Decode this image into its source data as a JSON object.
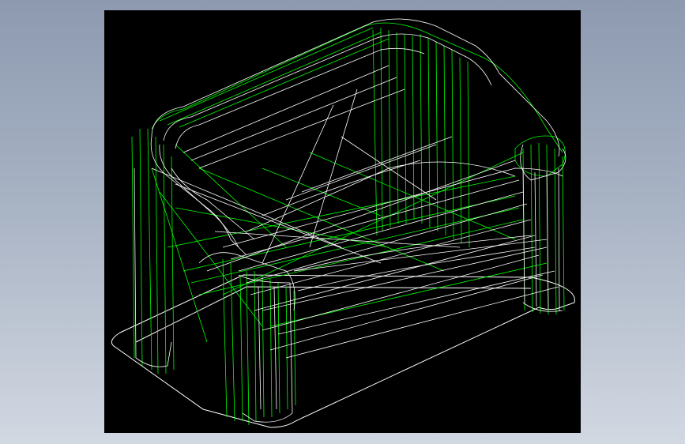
{
  "app": {
    "background_top": "#8d9ab0",
    "background_bottom": "#d2d8e2"
  },
  "viewport": {
    "background": "#000000",
    "render_mode": "wireframe",
    "model": "sofa",
    "colors": {
      "silhouette_edges": "#ffffff",
      "mesh_edges": "#00ff00"
    }
  }
}
